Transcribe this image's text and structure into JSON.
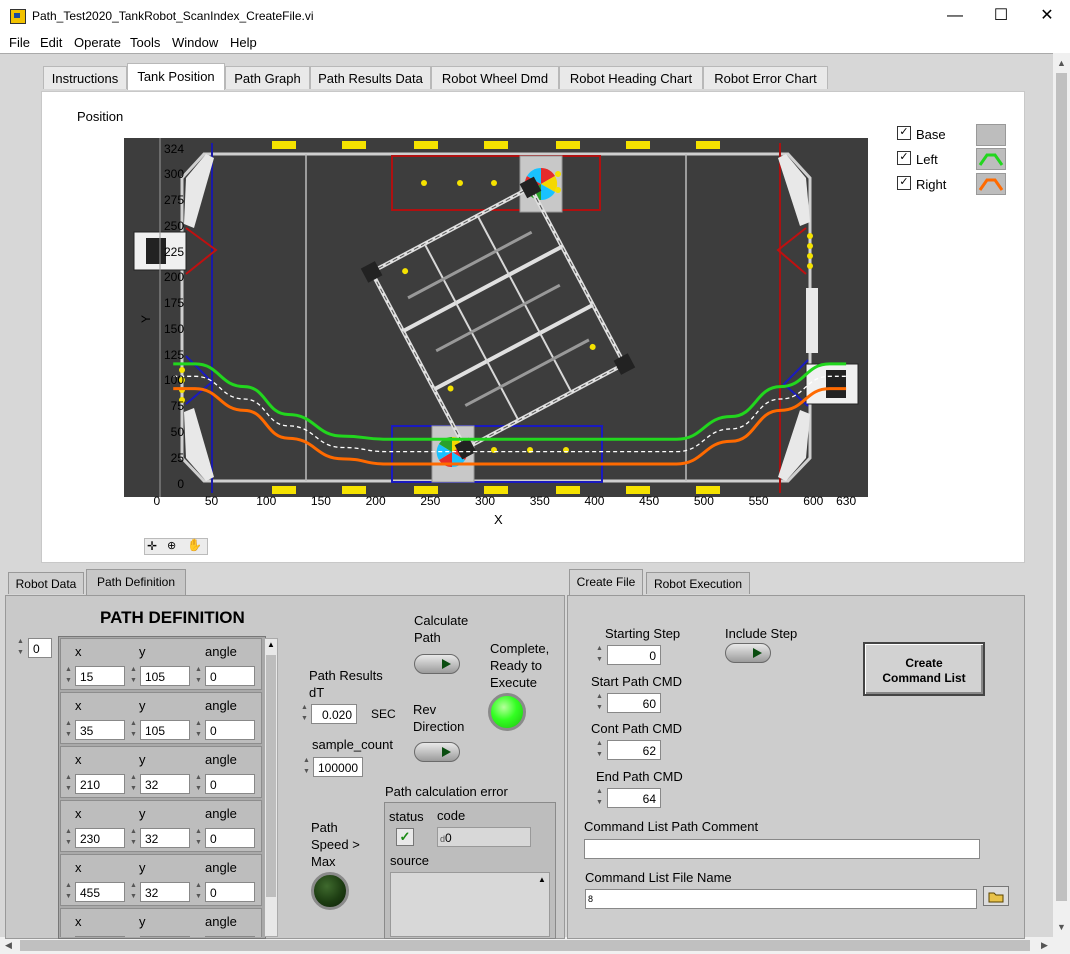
{
  "window": {
    "title": "Path_Test2020_TankRobot_ScanIndex_CreateFile.vi",
    "minimize": "—",
    "maximize": "☐",
    "close": "✕"
  },
  "menu": [
    "File",
    "Edit",
    "Operate",
    "Tools",
    "Window",
    "Help"
  ],
  "top_tabs": [
    {
      "label": "Instructions"
    },
    {
      "label": "Tank Position",
      "active": true
    },
    {
      "label": "Path Graph"
    },
    {
      "label": "Path Results Data"
    },
    {
      "label": "Robot Wheel Dmd"
    },
    {
      "label": "Robot Heading Chart"
    },
    {
      "label": "Robot Error Chart"
    }
  ],
  "position_plot": {
    "label": "Position",
    "xlabel": "X",
    "ylabel": "Y",
    "x_ticks": [
      "0",
      "50",
      "100",
      "150",
      "200",
      "250",
      "300",
      "350",
      "400",
      "450",
      "500",
      "550",
      "600",
      "630"
    ],
    "x_tick_values": [
      0,
      50,
      100,
      150,
      200,
      250,
      300,
      350,
      400,
      450,
      500,
      550,
      600,
      630
    ],
    "y_ticks": [
      "0",
      "25",
      "50",
      "75",
      "100",
      "125",
      "150",
      "175",
      "200",
      "225",
      "250",
      "275",
      "300",
      "324"
    ],
    "y_tick_values": [
      0,
      25,
      50,
      75,
      100,
      125,
      150,
      175,
      200,
      225,
      250,
      275,
      300,
      324
    ],
    "xlim": [
      -30,
      650
    ],
    "ylim": [
      -12,
      336
    ],
    "legend": [
      {
        "name": "Base",
        "checked": true,
        "color": "#bdbdbd"
      },
      {
        "name": "Left",
        "checked": true,
        "color": "#22d61e"
      },
      {
        "name": "Right",
        "checked": true,
        "color": "#ff6a00"
      }
    ],
    "left_path": [
      [
        15,
        117
      ],
      [
        35,
        117
      ],
      [
        80,
        95
      ],
      [
        120,
        68
      ],
      [
        170,
        47
      ],
      [
        210,
        44
      ],
      [
        230,
        44
      ],
      [
        455,
        44
      ],
      [
        475,
        44
      ],
      [
        525,
        66
      ],
      [
        570,
        95
      ],
      [
        615,
        117
      ],
      [
        630,
        117
      ]
    ],
    "right_path": [
      [
        15,
        93
      ],
      [
        35,
        93
      ],
      [
        80,
        72
      ],
      [
        120,
        45
      ],
      [
        170,
        25
      ],
      [
        210,
        20
      ],
      [
        230,
        20
      ],
      [
        455,
        20
      ],
      [
        475,
        20
      ],
      [
        525,
        42
      ],
      [
        570,
        72
      ],
      [
        615,
        93
      ],
      [
        630,
        93
      ]
    ],
    "center_path": [
      [
        15,
        105
      ],
      [
        35,
        105
      ],
      [
        80,
        83
      ],
      [
        120,
        57
      ],
      [
        170,
        36
      ],
      [
        210,
        32
      ],
      [
        230,
        32
      ],
      [
        455,
        32
      ],
      [
        475,
        32
      ],
      [
        525,
        54
      ],
      [
        570,
        83
      ],
      [
        615,
        105
      ],
      [
        630,
        105
      ]
    ]
  },
  "bottom_left_tabs": [
    {
      "label": "Robot Data"
    },
    {
      "label": "Path Definition",
      "active": true
    }
  ],
  "path_definition": {
    "heading": "PATH DEFINITION",
    "index": "0",
    "col_x": "x",
    "col_y": "y",
    "col_angle": "angle",
    "rows": [
      {
        "x": "15",
        "y": "105",
        "angle": "0"
      },
      {
        "x": "35",
        "y": "105",
        "angle": "0"
      },
      {
        "x": "210",
        "y": "32",
        "angle": "0"
      },
      {
        "x": "230",
        "y": "32",
        "angle": "0"
      },
      {
        "x": "455",
        "y": "32",
        "angle": "0"
      },
      {
        "x": "",
        "y": "",
        "angle": ""
      }
    ]
  },
  "controls": {
    "calculate_path": "Calculate Path",
    "complete_ready": "Complete, Ready to Execute",
    "path_results_dt": "Path Results dT",
    "dt_value": "0.020",
    "dt_unit": "SEC",
    "rev_direction": "Rev Direction",
    "sample_count_label": "sample_count",
    "sample_count": "100000",
    "path_speed_max": "Path Speed > Max",
    "error_cluster_title": "Path calculation error",
    "status_label": "status",
    "code_label": "code",
    "code_value": "0",
    "code_prefix": "d",
    "source_label": "source",
    "status_check": "✓"
  },
  "bottom_right_tabs": [
    {
      "label": "Create File",
      "active": true
    },
    {
      "label": "Robot Execution"
    }
  ],
  "create_file": {
    "starting_step_label": "Starting Step",
    "starting_step": "0",
    "include_step": "Include Step",
    "start_path_cmd_label": "Start Path CMD",
    "start_path_cmd": "60",
    "cont_path_cmd_label": "Cont Path CMD",
    "cont_path_cmd": "62",
    "end_path_cmd_label": "End Path CMD",
    "end_path_cmd": "64",
    "create_command_list": "Create Command List",
    "comment_label": "Command List Path Comment",
    "comment_value": "",
    "file_name_label": "Command List File Name",
    "file_name_value": "",
    "file_prefix": "8"
  },
  "colors": {
    "led_on": "#33ff22",
    "led_off": "#1d3d12",
    "left_path": "#22d61e",
    "right_path": "#ff6a00"
  }
}
